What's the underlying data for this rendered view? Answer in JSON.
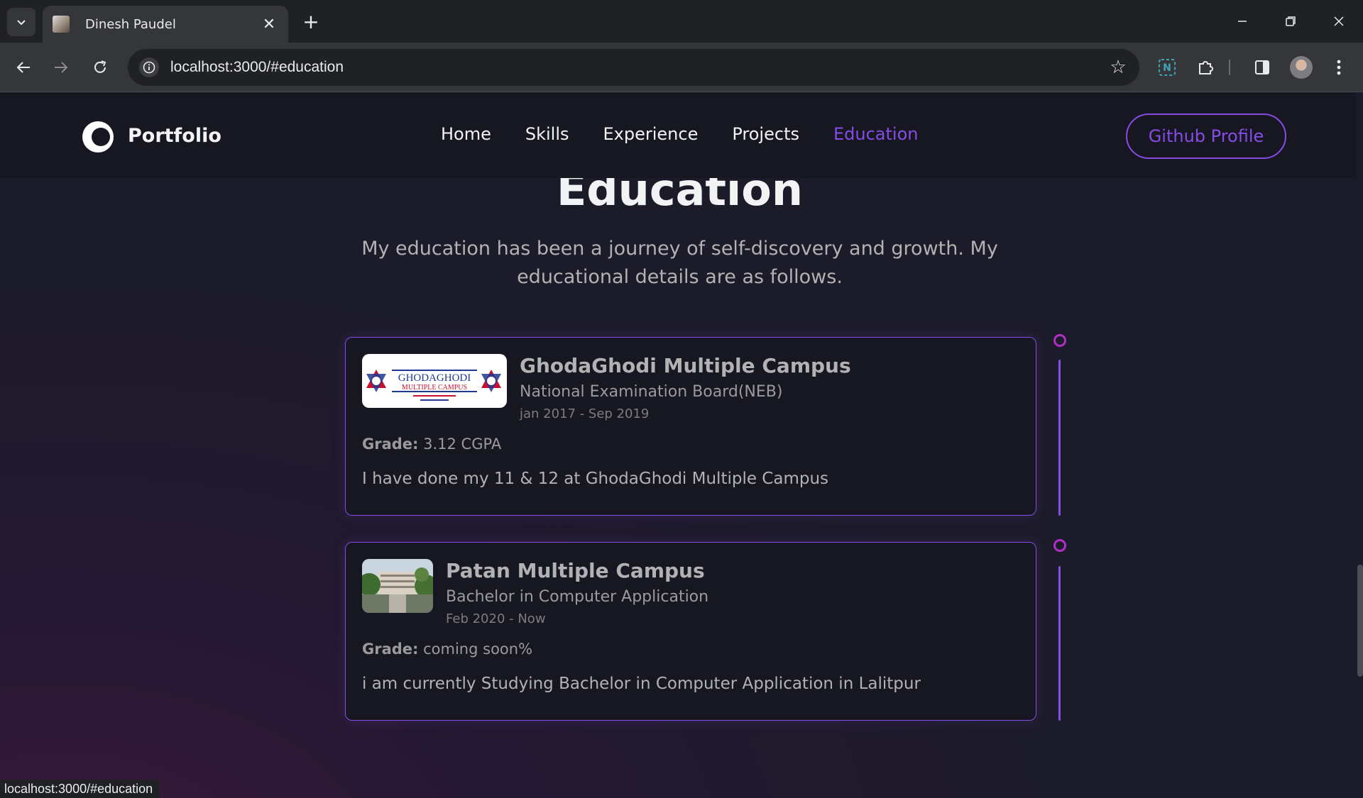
{
  "browser": {
    "tab_title": "Dinesh Paudel",
    "url": "localhost:3000/#education",
    "status_url": "localhost:3000/#education"
  },
  "site": {
    "logo_text": "Portfolio",
    "nav": [
      "Home",
      "Skills",
      "Experience",
      "Projects",
      "Education"
    ],
    "active_nav": "Education",
    "github_button": "Github Profile"
  },
  "section": {
    "title": "Education",
    "description": "My education has been a journey of self-discovery and growth. My educational details are as follows."
  },
  "education": [
    {
      "school": "GhodaGhodi Multiple Campus",
      "degree": "National Examination Board(NEB)",
      "date": "jan 2017 - Sep 2019",
      "grade_label": "Grade:",
      "grade": "3.12 CGPA",
      "desc": "I have done my 11 & 12 at GhodaGhodi Multiple Campus",
      "logo_text_main": "GHODAGHODI",
      "logo_text_sub": "MULTIPLE CAMPUS"
    },
    {
      "school": "Patan Multiple Campus",
      "degree": "Bachelor in Computer Application",
      "date": "Feb 2020 - Now",
      "grade_label": "Grade:",
      "grade": "coming soon%",
      "desc": "i am currently Studying Bachelor in Computer Application in Lalitpur"
    }
  ],
  "colors": {
    "accent": "#854ce6",
    "timeline_dot": "#b12fc8",
    "background": "#1c1b29",
    "nav_background": "#171721"
  }
}
